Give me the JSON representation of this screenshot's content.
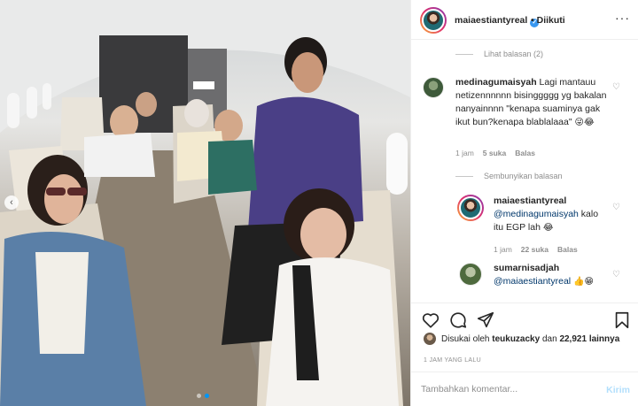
{
  "post": {
    "author": "maiaestiantyreal",
    "follow_separator": "•",
    "follow_status": "Diikuti",
    "more_icon": "more-horizontal-icon",
    "slides": 2,
    "active_slide": 2
  },
  "comments": {
    "view_replies_top": "Lihat balasan (2)",
    "items": [
      {
        "username": "medinagumaisyah",
        "text": "Lagi mantauu netizennnnnn bisinggggg yg bakalan nanyainnnn \"kenapa suaminya gak ikut bun?kenapa blablalaaa\"",
        "emoji": "😜😂",
        "time": "1 jam",
        "likes": "5 suka",
        "reply": "Balas"
      }
    ],
    "hide_replies": "Sembunyikan balasan",
    "replies": [
      {
        "username": "maiaestiantyreal",
        "mention": "@medinagumaisyah",
        "text": "kalo itu EGP lah",
        "emoji": "😂",
        "time": "1 jam",
        "likes": "22 suka",
        "reply": "Balas"
      },
      {
        "username": "sumarnisadjah",
        "mention": "@maiaestiantyreal",
        "emoji": "👍😁"
      }
    ]
  },
  "actions": {
    "like_icon": "heart-icon",
    "comment_icon": "comment-icon",
    "share_icon": "share-icon",
    "save_icon": "bookmark-icon"
  },
  "likes": {
    "prefix": "Disukai oleh",
    "user": "teukuzacky",
    "conj": "dan",
    "count": "22,921",
    "suffix": "lainnya"
  },
  "timestamp": "1 JAM YANG LALU",
  "add_comment": {
    "placeholder": "Tambahkan komentar...",
    "post_label": "Kirim"
  }
}
